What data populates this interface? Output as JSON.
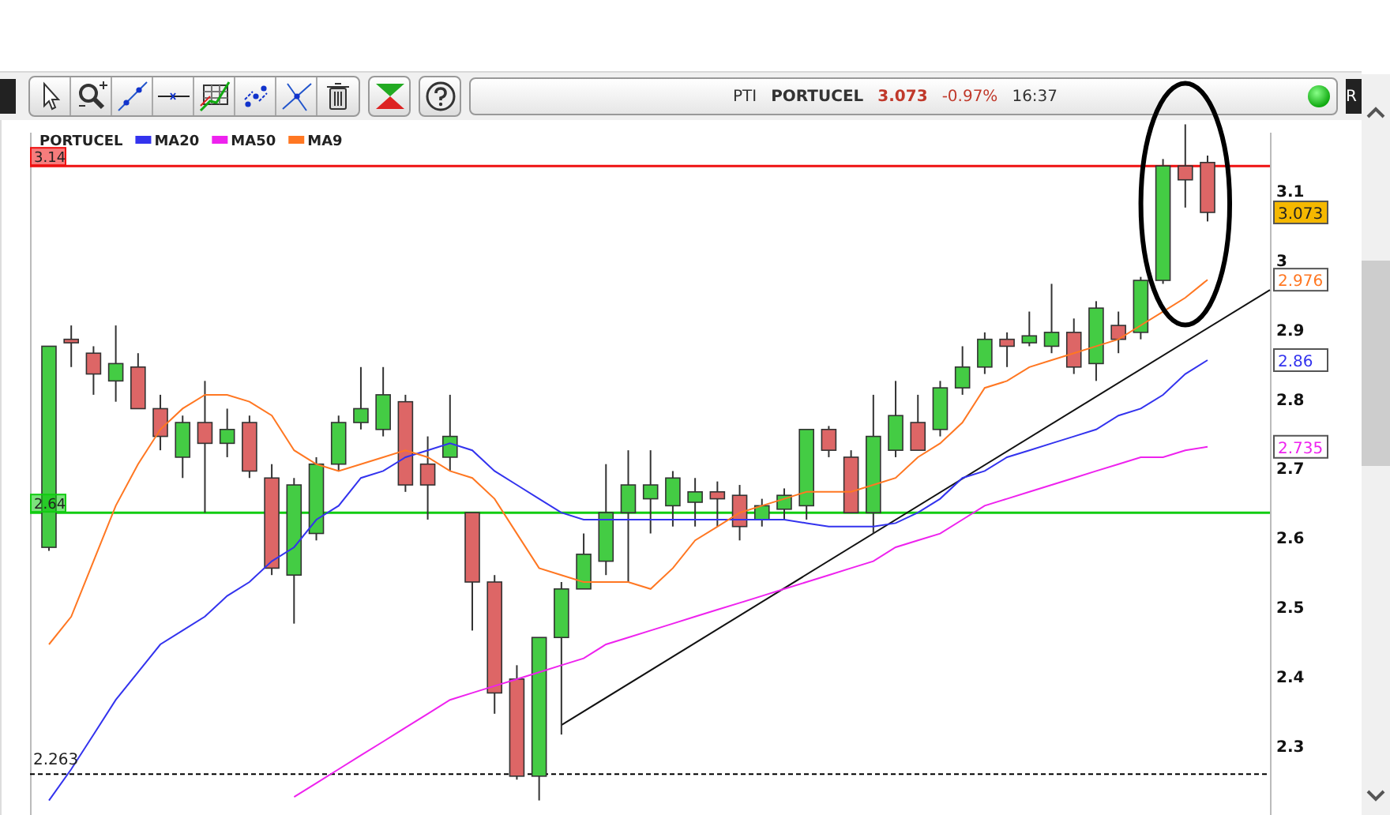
{
  "edge_tab": {
    "label": "R"
  },
  "quote": {
    "symbol": "PTI",
    "name": "PORTUCEL",
    "price": "3.073",
    "change": "-0.97%",
    "time": "16:37",
    "connected": true
  },
  "chart": {
    "value_tags": [
      {
        "label": "3.073",
        "color": "#f5b800"
      },
      {
        "label": "2.976",
        "color": "#ff7722"
      },
      {
        "label": "2.86",
        "color": "#3333ee"
      },
      {
        "label": "2.735",
        "color": "#ee22ee"
      }
    ],
    "chart_data": {
      "type": "candlestick",
      "title": "PORTUCEL",
      "ylim": [
        2.204,
        3.188
      ],
      "categories": [
        null,
        null,
        null,
        null,
        null,
        null,
        null,
        null,
        null,
        null,
        null,
        null,
        null,
        null,
        null,
        null,
        null,
        null,
        null,
        null,
        null,
        null,
        null,
        null,
        null,
        null,
        null,
        null,
        null,
        null,
        null,
        null,
        null,
        null,
        null,
        null,
        null,
        null,
        null,
        null,
        null,
        null,
        null,
        null,
        null,
        null,
        null,
        null,
        null,
        null,
        null,
        null,
        null
      ],
      "yticks": [
        {
          "value": 3.1,
          "label": "3.1"
        },
        {
          "value": 3.0,
          "label": "3"
        },
        {
          "value": 2.9,
          "label": "2.9"
        },
        {
          "value": 2.8,
          "label": "2.8"
        },
        {
          "value": 2.7,
          "label": "2.7"
        },
        {
          "value": 2.6,
          "label": "2.6"
        },
        {
          "value": 2.5,
          "label": "2.5"
        },
        {
          "value": 2.4,
          "label": "2.4"
        },
        {
          "value": 2.3,
          "label": "2.3"
        }
      ],
      "ohlc": [
        [
          2.59,
          2.88,
          2.585,
          2.88
        ],
        [
          2.89,
          2.91,
          2.85,
          2.885
        ],
        [
          2.87,
          2.88,
          2.81,
          2.84
        ],
        [
          2.83,
          2.91,
          2.8,
          2.855
        ],
        [
          2.85,
          2.87,
          2.79,
          2.79
        ],
        [
          2.79,
          2.81,
          2.73,
          2.75
        ],
        [
          2.72,
          2.78,
          2.69,
          2.77
        ],
        [
          2.77,
          2.83,
          2.64,
          2.74
        ],
        [
          2.74,
          2.79,
          2.72,
          2.76
        ],
        [
          2.77,
          2.78,
          2.69,
          2.7
        ],
        [
          2.69,
          2.71,
          2.55,
          2.56
        ],
        [
          2.55,
          2.69,
          2.48,
          2.68
        ],
        [
          2.61,
          2.72,
          2.6,
          2.71
        ],
        [
          2.71,
          2.78,
          2.7,
          2.77
        ],
        [
          2.77,
          2.85,
          2.76,
          2.79
        ],
        [
          2.76,
          2.85,
          2.75,
          2.81
        ],
        [
          2.8,
          2.81,
          2.67,
          2.68
        ],
        [
          2.71,
          2.75,
          2.63,
          2.68
        ],
        [
          2.72,
          2.81,
          2.7,
          2.75
        ],
        [
          2.64,
          2.64,
          2.47,
          2.54
        ],
        [
          2.54,
          2.55,
          2.35,
          2.38
        ],
        [
          2.4,
          2.42,
          2.255,
          2.26
        ],
        [
          2.26,
          2.46,
          2.225,
          2.46
        ],
        [
          2.46,
          2.54,
          2.32,
          2.53
        ],
        [
          2.53,
          2.61,
          2.53,
          2.58
        ],
        [
          2.57,
          2.71,
          2.55,
          2.64
        ],
        [
          2.64,
          2.73,
          2.54,
          2.68
        ],
        [
          2.66,
          2.73,
          2.61,
          2.68
        ],
        [
          2.65,
          2.7,
          2.62,
          2.69
        ],
        [
          2.655,
          2.69,
          2.62,
          2.67
        ],
        [
          2.67,
          2.685,
          2.62,
          2.66
        ],
        [
          2.665,
          2.68,
          2.6,
          2.62
        ],
        [
          2.63,
          2.66,
          2.62,
          2.65
        ],
        [
          2.645,
          2.675,
          2.63,
          2.665
        ],
        [
          2.65,
          2.76,
          2.63,
          2.76
        ],
        [
          2.76,
          2.765,
          2.72,
          2.73
        ],
        [
          2.72,
          2.73,
          2.64,
          2.64
        ],
        [
          2.64,
          2.81,
          2.61,
          2.75
        ],
        [
          2.73,
          2.83,
          2.72,
          2.78
        ],
        [
          2.77,
          2.81,
          2.73,
          2.73
        ],
        [
          2.76,
          2.83,
          2.75,
          2.82
        ],
        [
          2.82,
          2.88,
          2.81,
          2.85
        ],
        [
          2.85,
          2.9,
          2.84,
          2.89
        ],
        [
          2.89,
          2.9,
          2.85,
          2.88
        ],
        [
          2.885,
          2.93,
          2.88,
          2.895
        ],
        [
          2.88,
          2.97,
          2.87,
          2.9
        ],
        [
          2.9,
          2.92,
          2.84,
          2.85
        ],
        [
          2.855,
          2.945,
          2.83,
          2.935
        ],
        [
          2.91,
          2.93,
          2.87,
          2.89
        ],
        [
          2.9,
          2.98,
          2.89,
          2.975
        ],
        [
          2.975,
          3.15,
          2.97,
          3.14
        ],
        [
          3.14,
          3.2,
          3.08,
          3.12
        ],
        [
          3.145,
          3.155,
          3.06,
          3.073
        ]
      ],
      "series": [
        {
          "name": "MA20",
          "color": "#3333ee",
          "type": "line",
          "values": [
            2.225,
            2.27,
            2.32,
            2.37,
            2.41,
            2.45,
            2.47,
            2.49,
            2.52,
            2.54,
            2.57,
            2.59,
            2.63,
            2.65,
            2.69,
            2.7,
            2.72,
            2.73,
            2.74,
            2.73,
            2.7,
            2.68,
            2.66,
            2.64,
            2.63,
            2.63,
            2.63,
            2.63,
            2.63,
            2.63,
            2.63,
            2.63,
            2.63,
            2.63,
            2.625,
            2.62,
            2.62,
            2.62,
            2.625,
            2.64,
            2.66,
            2.69,
            2.7,
            2.72,
            2.73,
            2.74,
            2.75,
            2.76,
            2.78,
            2.79,
            2.81,
            2.84,
            2.86
          ]
        },
        {
          "name": "MA50",
          "color": "#ee22ee",
          "type": "line",
          "values": [
            null,
            null,
            null,
            null,
            null,
            null,
            null,
            null,
            null,
            null,
            null,
            2.23,
            2.25,
            2.27,
            2.29,
            2.31,
            2.33,
            2.35,
            2.37,
            2.38,
            2.39,
            2.4,
            2.41,
            2.42,
            2.43,
            2.45,
            2.46,
            2.47,
            2.48,
            2.49,
            2.5,
            2.51,
            2.52,
            2.53,
            2.54,
            2.55,
            2.56,
            2.57,
            2.59,
            2.6,
            2.61,
            2.63,
            2.65,
            2.66,
            2.67,
            2.68,
            2.69,
            2.7,
            2.71,
            2.72,
            2.72,
            2.73,
            2.735
          ]
        },
        {
          "name": "MA9",
          "color": "#ff7722",
          "type": "line",
          "values": [
            2.45,
            2.49,
            2.57,
            2.65,
            2.71,
            2.76,
            2.79,
            2.81,
            2.81,
            2.8,
            2.78,
            2.73,
            2.71,
            2.7,
            2.71,
            2.72,
            2.73,
            2.72,
            2.7,
            2.69,
            2.66,
            2.61,
            2.56,
            2.55,
            2.54,
            2.54,
            2.54,
            2.53,
            2.56,
            2.6,
            2.62,
            2.64,
            2.65,
            2.66,
            2.67,
            2.67,
            2.67,
            2.68,
            2.69,
            2.72,
            2.74,
            2.77,
            2.82,
            2.83,
            2.85,
            2.86,
            2.87,
            2.88,
            2.89,
            2.91,
            2.93,
            2.95,
            2.976
          ]
        }
      ],
      "ref_lines": [
        {
          "axis": "y",
          "value": 3.14,
          "label": "3.14",
          "color": "#ee1111"
        },
        {
          "axis": "y",
          "value": 2.64,
          "label": "2.64",
          "color": "#11cc11"
        },
        {
          "axis": "y",
          "value": 2.263,
          "label": "2.263",
          "color": "#000000"
        }
      ],
      "legend": true
    }
  }
}
